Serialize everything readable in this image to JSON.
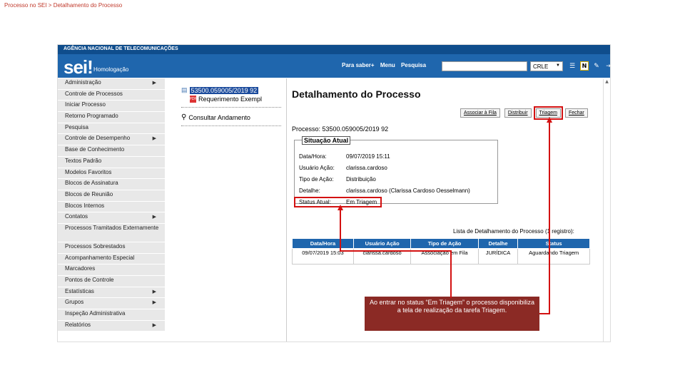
{
  "slide_title": "Processo no SEI > Detalhamento do Processo",
  "agency": "AGÊNCIA NACIONAL DE TELECOMUNICAÇÕES",
  "logo": {
    "text": "sei!",
    "subtitle": "Homologação"
  },
  "top_links": [
    "Para saber+",
    "Menu",
    "Pesquisa"
  ],
  "unit_select": "CRLE",
  "menu": [
    {
      "label": "Administração",
      "has_sub": true
    },
    {
      "label": "Controle de Processos",
      "has_sub": false
    },
    {
      "label": "Iniciar Processo",
      "has_sub": false
    },
    {
      "label": "Retorno Programado",
      "has_sub": false
    },
    {
      "label": "Pesquisa",
      "has_sub": false
    },
    {
      "label": "Controle de Desempenho",
      "has_sub": true
    },
    {
      "label": "Base de Conhecimento",
      "has_sub": false
    },
    {
      "label": "Textos Padrão",
      "has_sub": false
    },
    {
      "label": "Modelos Favoritos",
      "has_sub": false
    },
    {
      "label": "Blocos de Assinatura",
      "has_sub": false
    },
    {
      "label": "Blocos de Reunião",
      "has_sub": false
    },
    {
      "label": "Blocos Internos",
      "has_sub": false
    },
    {
      "label": "Contatos",
      "has_sub": true
    },
    {
      "label": "Processos Tramitados Externamente",
      "has_sub": false
    },
    {
      "label": "Processos Sobrestados",
      "has_sub": false
    },
    {
      "label": "Acompanhamento Especial",
      "has_sub": false
    },
    {
      "label": "Marcadores",
      "has_sub": false
    },
    {
      "label": "Pontos de Controle",
      "has_sub": false
    },
    {
      "label": "Estatísticas",
      "has_sub": true
    },
    {
      "label": "Grupos",
      "has_sub": true
    },
    {
      "label": "Inspeção Administrativa",
      "has_sub": false
    },
    {
      "label": "Relatórios",
      "has_sub": true
    }
  ],
  "tree": {
    "process_number": "53500.059005/2019 92",
    "document": "Requerimento Exempl",
    "consult": "Consultar Andamento"
  },
  "detail": {
    "title": "Detalhamento do Processo",
    "buttons": [
      "Associar à Fila",
      "Distribuir",
      "Triagem",
      "Fechar"
    ],
    "process_label": "Processo: 53500.059005/2019 92",
    "situation_legend": "Situação Atual",
    "rows": [
      {
        "k": "Data/Hora:",
        "v": "09/07/2019 15:11"
      },
      {
        "k": "Usuário Ação:",
        "v": "clarissa.cardoso"
      },
      {
        "k": "Tipo de Ação:",
        "v": "Distribuição"
      },
      {
        "k": "Detalhe:",
        "v": "clarissa.cardoso (Clarissa Cardoso Oesselmann)"
      },
      {
        "k": "Status Atual:",
        "v": "Em Triagem"
      }
    ],
    "table_caption": "Lista de Detalhamento do Processo (1 registro):",
    "table_headers": [
      "Data/Hora",
      "Usuário Ação",
      "Tipo de Ação",
      "Detalhe",
      "Status"
    ],
    "table_rows": [
      [
        "09/07/2019 15:03",
        "clarissa.cardoso",
        "Associação em Fila",
        "JURÍDICA",
        "Aguardando Triagem"
      ]
    ]
  },
  "callout": "Ao entrar no status “Em Triagem” o processo disponibiliza a tela de realização da tarefa Triagem.",
  "colors": {
    "header": "#1f66ad",
    "highlight": "#d31111",
    "callout": "#8b2a25"
  }
}
